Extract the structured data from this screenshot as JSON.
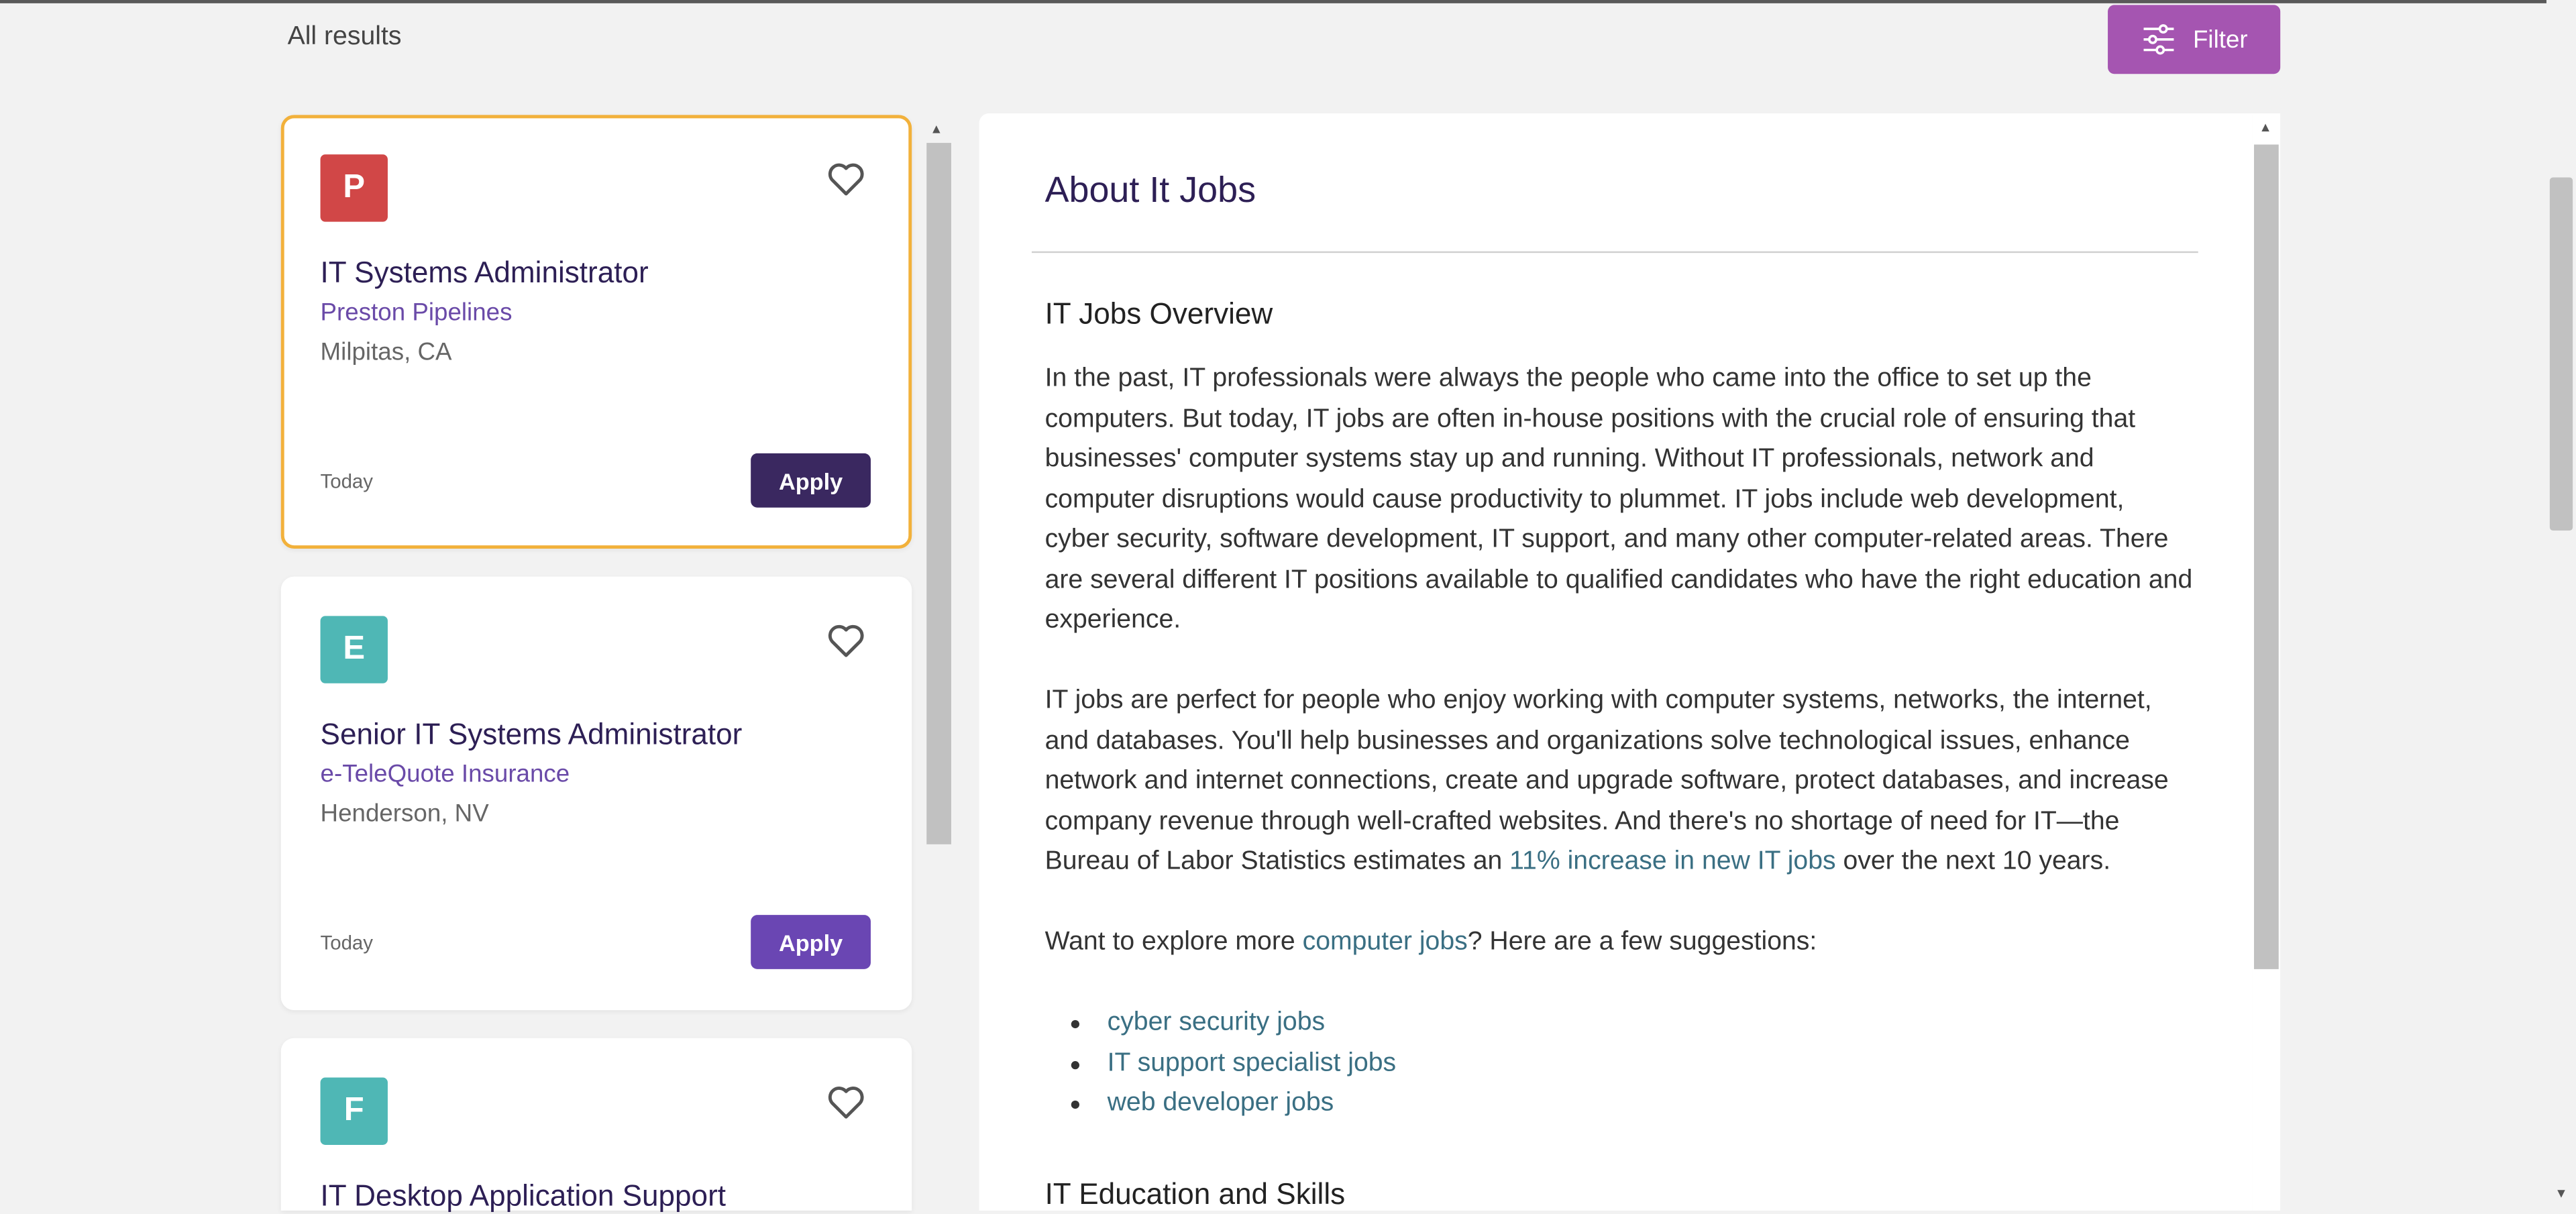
{
  "header": {
    "results_label": "All results",
    "filter_label": "Filter"
  },
  "jobs": [
    {
      "logo_letter": "P",
      "logo_color": "#d14747",
      "title": "IT Systems Administrator",
      "company": "Preston Pipelines",
      "location": "Milpitas, CA",
      "posted": "Today",
      "apply_label": "Apply",
      "apply_color": "#3a2860",
      "selected": true
    },
    {
      "logo_letter": "E",
      "logo_color": "#4fb7b5",
      "title": "Senior IT Systems Administrator",
      "company": "e-TeleQuote Insurance",
      "location": "Henderson, NV",
      "posted": "Today",
      "apply_label": "Apply",
      "apply_color": "#6a46b3",
      "selected": false
    },
    {
      "logo_letter": "F",
      "logo_color": "#4fb7b5",
      "title": "IT Desktop Application Support",
      "selected": false
    }
  ],
  "detail": {
    "heading": "About It Jobs",
    "overview_heading": "IT Jobs Overview",
    "para1": "In the past, IT professionals were always the people who came into the office to set up the computers. But today, IT jobs are often in-house positions with the crucial role of ensuring that businesses' computer systems stay up and running. Without IT professionals, network and computer disruptions would cause productivity to plummet. IT jobs include web development, cyber security, software development, IT support, and many other computer-related areas. There are several different IT positions available to qualified candidates who have the right education and experience.",
    "para2_before": "IT jobs are perfect for people who enjoy working with computer systems, networks, the internet, and databases. You'll help businesses and organizations solve technological issues, enhance network and internet connections, create and upgrade software, protect databases, and increase company revenue through well-crafted websites. And there's no shortage of need for IT—the Bureau of Labor Statistics estimates an ",
    "para2_link": "11% increase in new IT jobs",
    "para2_after": " over the next 10 years.",
    "para3_before": "Want to explore more ",
    "para3_link": "computer jobs",
    "para3_after": "? Here are a few suggestions:",
    "suggestions": [
      "cyber security jobs",
      "IT support specialist jobs",
      "web developer jobs"
    ],
    "education_heading": "IT Education and Skills"
  },
  "colors": {
    "filter_button": "#a555b1",
    "selected_border": "#f2b13b",
    "link": "#3a6f83",
    "title": "#2d1f55",
    "company": "#6a4aa8"
  },
  "icons": [
    "filter-sliders-icon",
    "heart-outline-icon"
  ]
}
